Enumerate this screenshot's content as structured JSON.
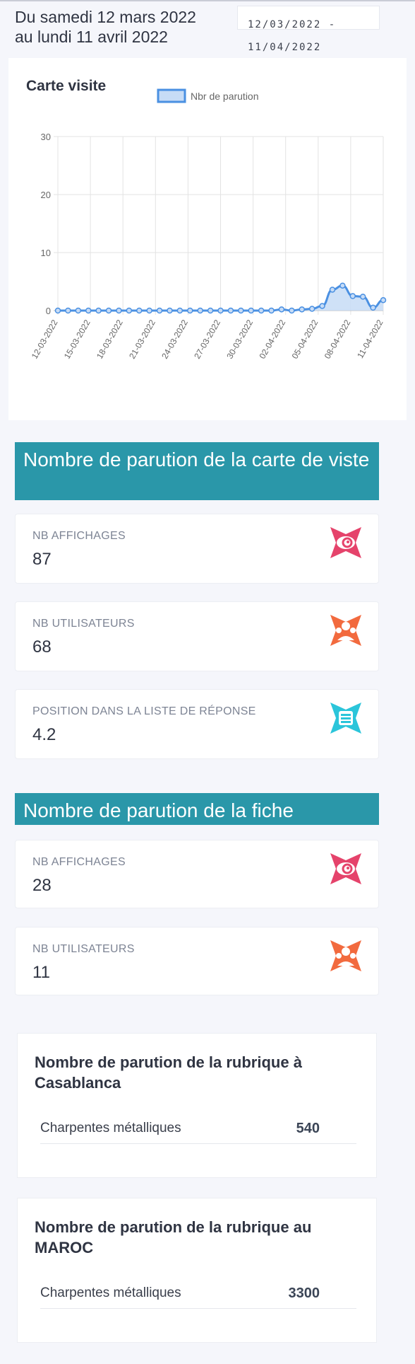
{
  "header": {
    "period_line1": "Du samedi 12 mars 2022",
    "period_line2": "au lundi 11 avril 2022",
    "date_range_line1": "12/03/2022 -",
    "date_range_line2": "11/04/2022"
  },
  "chart_card": {
    "title": "Carte visite"
  },
  "chart_data": {
    "type": "area",
    "legend_position": "top",
    "grid": true,
    "series": [
      {
        "name": "Nbr de parution",
        "values": [
          0,
          0,
          0,
          0,
          0,
          0,
          0,
          0,
          0,
          0,
          0,
          0,
          0,
          0,
          0,
          0,
          0,
          0,
          0,
          0,
          0,
          0,
          0.2,
          0,
          0.2,
          0.3,
          0.8,
          3.6,
          4.3,
          2.5,
          2.4,
          0.5,
          1.8
        ]
      }
    ],
    "x": [
      "12-03-2022",
      "13-03-2022",
      "14-03-2022",
      "15-03-2022",
      "16-03-2022",
      "17-03-2022",
      "18-03-2022",
      "19-03-2022",
      "20-03-2022",
      "21-03-2022",
      "22-03-2022",
      "23-03-2022",
      "24-03-2022",
      "25-03-2022",
      "26-03-2022",
      "27-03-2022",
      "28-03-2022",
      "29-03-2022",
      "30-03-2022",
      "31-03-2022",
      "01-04-2022",
      "02-04-2022",
      "03-04-2022",
      "04-04-2022",
      "05-04-2022",
      "06-04-2022",
      "07-04-2022",
      "08-04-2022",
      "09-04-2022",
      "10-04-2022",
      "11-04-2022",
      "11-04-2022",
      "11-04-2022"
    ],
    "x_tick_labels": [
      "12-03-2022",
      "15-03-2022",
      "18-03-2022",
      "21-03-2022",
      "24-03-2022",
      "27-03-2022",
      "30-03-2022",
      "02-04-2022",
      "05-04-2022",
      "08-04-2022",
      "11-04-2022"
    ],
    "y_ticks": [
      "0",
      "10",
      "20",
      "30"
    ],
    "ylim": [
      0,
      30
    ],
    "colors": {
      "line": "#4a90e2",
      "fill": "#c7dcf6"
    }
  },
  "section1": {
    "title": "Nombre de parution de la carte de viste",
    "stats": [
      {
        "label": "NB AFFICHAGES",
        "value": "87",
        "icon": "eye-icon",
        "color": "#e5436b"
      },
      {
        "label": "NB UTILISATEURS",
        "value": "68",
        "icon": "users-icon",
        "color": "#f26a3e"
      },
      {
        "label": "POSITION DANS LA LISTE DE RÉPONSE",
        "value": "4.2",
        "icon": "list-icon",
        "color": "#2bc5da"
      }
    ]
  },
  "section2": {
    "title": "Nombre de parution de la fiche",
    "stats": [
      {
        "label": "NB AFFICHAGES",
        "value": "28",
        "icon": "eye-icon",
        "color": "#e5436b"
      },
      {
        "label": "NB UTILISATEURS",
        "value": "11",
        "icon": "users-icon",
        "color": "#f26a3e"
      }
    ]
  },
  "rubrique_casa": {
    "title": "Nombre de parution de la rubrique à Casablanca",
    "rows": [
      {
        "name": "Charpentes métalliques",
        "value": "540"
      }
    ]
  },
  "rubrique_maroc": {
    "title": "Nombre de parution de la rubrique au MAROC",
    "rows": [
      {
        "name": "Charpentes métalliques",
        "value": "3300"
      }
    ]
  }
}
